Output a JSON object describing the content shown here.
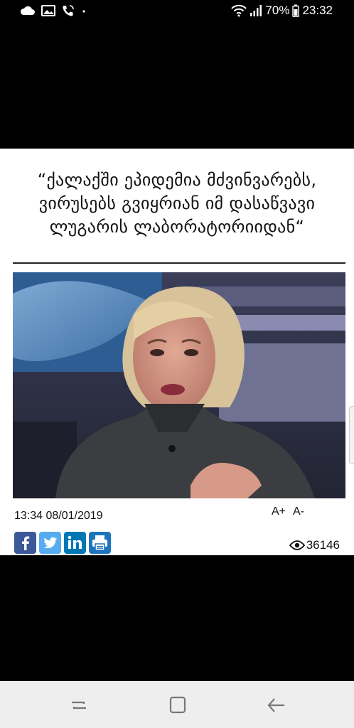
{
  "status_bar": {
    "battery": "70%",
    "time": "23:32",
    "icons": [
      "cloud-icon",
      "gallery-icon",
      "phone-call-icon",
      "dot-icon",
      "wifi-icon",
      "signal-icon",
      "battery-icon"
    ]
  },
  "article": {
    "headline": "“ქალაქში ეპიდემია მძვინვარებს, ვირუსებს გვიყრიან იმ დასაწვავი ლუგარის ლაბორატორიიდან“",
    "datetime": "13:34 08/01/2019",
    "font_increase": "A+",
    "font_decrease": "A-",
    "views": "36146"
  },
  "share": [
    {
      "name": "facebook",
      "label": "f",
      "color": "#3b5998"
    },
    {
      "name": "twitter",
      "label": "t",
      "color": "#55acee"
    },
    {
      "name": "linkedin",
      "label": "in",
      "color": "#0077b5"
    },
    {
      "name": "print",
      "label": "print",
      "color": "#1e73be"
    }
  ],
  "nav_bar": {
    "icons": [
      "recent-apps-icon",
      "home-icon",
      "back-icon"
    ]
  }
}
